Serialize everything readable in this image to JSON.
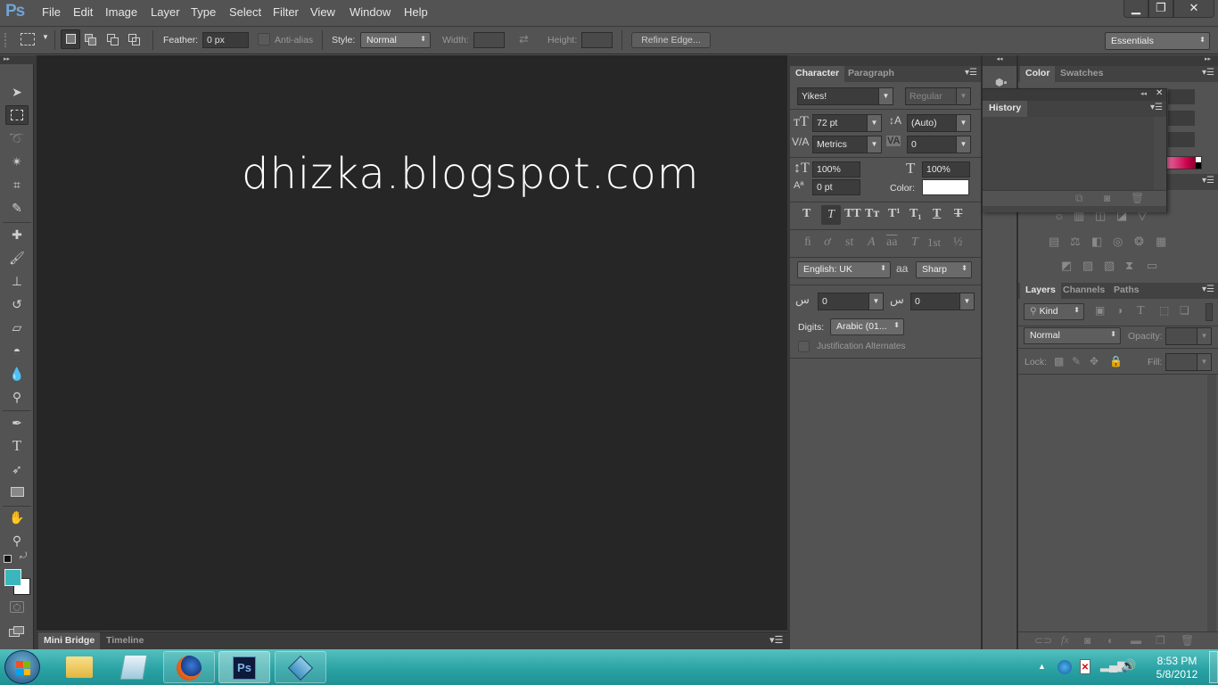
{
  "app": {
    "logo": "Ps"
  },
  "menu": [
    "File",
    "Edit",
    "Image",
    "Layer",
    "Type",
    "Select",
    "Filter",
    "View",
    "Window",
    "Help"
  ],
  "window_controls": {
    "minimize": "minimize-icon",
    "restore": "restore-icon",
    "close": "close-icon"
  },
  "options_bar": {
    "feather_label": "Feather:",
    "feather_value": "0 px",
    "anti_alias_label": "Anti-alias",
    "style_label": "Style:",
    "style_value": "Normal",
    "width_label": "Width:",
    "width_value": "",
    "height_label": "Height:",
    "height_value": "",
    "refine_edge": "Refine Edge...",
    "workspace": "Essentials"
  },
  "tools": [
    "move",
    "rectangular-marquee",
    "lasso",
    "magic-wand",
    "crop",
    "eyedropper",
    "spot-healing",
    "brush",
    "clone-stamp",
    "history-brush",
    "eraser",
    "paint-bucket",
    "blur",
    "dodge",
    "pen",
    "type",
    "path-selection",
    "rectangle",
    "hand",
    "zoom"
  ],
  "colors": {
    "foreground": "#3bb6bd",
    "background": "#ffffff",
    "canvas": "#262626",
    "accent": "#6fa3d6"
  },
  "canvas": {
    "text": "dhizka.blogspot.com"
  },
  "bottom_panel": {
    "tabs": [
      "Mini Bridge",
      "Timeline"
    ]
  },
  "character_panel": {
    "tabs": [
      "Character",
      "Paragraph"
    ],
    "font_family": "Yikes!",
    "font_style": "Regular",
    "font_size": "72 pt",
    "leading": "(Auto)",
    "kerning": "Metrics",
    "tracking": "0",
    "vertical_scale": "100%",
    "horizontal_scale": "100%",
    "baseline_shift": "0 pt",
    "color_label": "Color:",
    "text_color": "#ffffff",
    "style_buttons": [
      "T",
      "T",
      "TT",
      "Tт",
      "T¹",
      "T₁",
      "T",
      "T"
    ],
    "opentype_buttons": [
      "ﬁ",
      "ơ",
      "st",
      "A",
      "aa",
      "T",
      "1st",
      "½"
    ],
    "language": "English: UK",
    "antialias_label": "aa",
    "antialias": "Sharp",
    "kashida_1": "0",
    "kashida_2": "0",
    "digits_label": "Digits:",
    "digits": "Arabic (01...",
    "justification_alternates": "Justification Alternates"
  },
  "history_panel": {
    "tab": "History"
  },
  "color_panel": {
    "tabs": [
      "Color",
      "Swatches"
    ]
  },
  "layers_panel": {
    "tabs": [
      "Layers",
      "Channels",
      "Paths"
    ],
    "filter": "Kind",
    "blend_mode": "Normal",
    "opacity_label": "Opacity:",
    "opacity_value": "",
    "lock_label": "Lock:",
    "fill_label": "Fill:",
    "fill_value": ""
  },
  "taskbar": {
    "apps": [
      "start",
      "explorer",
      "notepad",
      "firefox",
      "photoshop",
      "remote-desktop"
    ],
    "time": "8:53 PM",
    "date": "5/8/2012"
  }
}
